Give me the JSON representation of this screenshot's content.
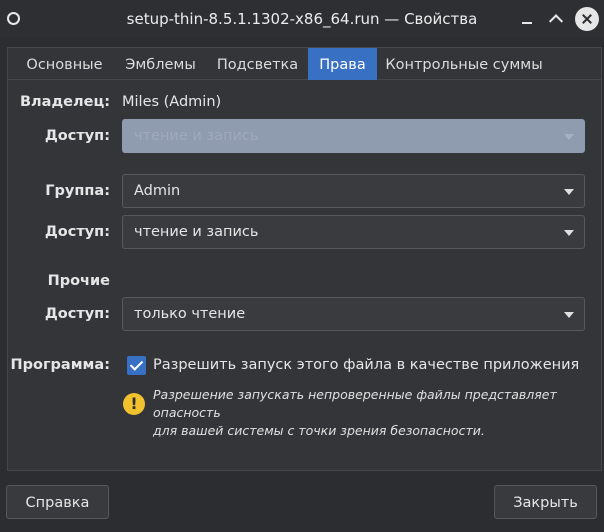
{
  "window": {
    "title": "setup-thin-8.5.1.1302-x86_64.run — Свойства"
  },
  "tabs": [
    "Основные",
    "Эмблемы",
    "Подсветка",
    "Права",
    "Контрольные суммы"
  ],
  "active_tab": "Права",
  "owner": {
    "label": "Владелец:",
    "value": "Miles (Admin)",
    "access_label": "Доступ:",
    "access_value": "чтение и запись"
  },
  "group": {
    "label": "Группа:",
    "value": "Admin",
    "access_label": "Доступ:",
    "access_value": "чтение и запись"
  },
  "others": {
    "heading": "Прочие",
    "access_label": "Доступ:",
    "access_value": "только чтение"
  },
  "program": {
    "label": "Программа:",
    "checkbox_label": "Разрешить запуск этого файла в качестве приложения",
    "checked": true,
    "warning_line1": "Разрешение запускать непроверенные файлы представляет опасность",
    "warning_line2": "для вашей системы с точки зрения безопасности."
  },
  "buttons": {
    "help": "Справка",
    "close": "Закрыть"
  },
  "colors": {
    "accent": "#3870c4",
    "warning": "#f2c12e"
  }
}
